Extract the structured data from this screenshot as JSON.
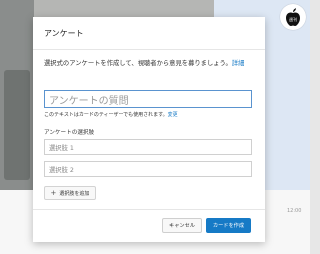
{
  "modal": {
    "title": "アンケート",
    "description": "選択式のアンケートを作成して、視聴者から意見を募りましょう。",
    "learn_more": "詳細",
    "question_placeholder": "アンケートの質問",
    "hint_text": "このテキストはカードのティーザーでも使用されます。",
    "hint_link": "変更",
    "choices_label": "アンケートの選択肢",
    "choices": [
      {
        "placeholder": "選択肢 1"
      },
      {
        "placeholder": "選択肢 2"
      }
    ],
    "add_choice_label": "選択肢を追加",
    "add_choice_icon": "plus-icon",
    "cancel_label": "キャンセル",
    "create_label": "カードを作成"
  },
  "background": {
    "time_label": "12:00"
  },
  "colors": {
    "accent": "#167ac6",
    "input_focus_border": "#5a93cf"
  }
}
